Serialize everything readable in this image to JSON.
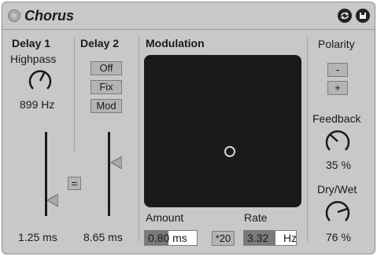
{
  "device": {
    "title": "Chorus",
    "power_icon": "power-icon",
    "hotswap_icon": "hotswap-icon",
    "save_icon": "save-icon"
  },
  "delay1": {
    "heading": "Delay 1",
    "highpass_label": "Highpass",
    "highpass_value": "899 Hz",
    "time_value": "1.25 ms",
    "fader_level": 0.2
  },
  "delay2": {
    "heading": "Delay 2",
    "mode_buttons": [
      "Off",
      "Fix",
      "Mod"
    ],
    "time_value": "8.65 ms",
    "fader_level": 0.6
  },
  "link_button": "=",
  "modulation": {
    "heading": "Modulation",
    "amount_label": "Amount",
    "amount_value": "0.80 ms",
    "rate_label": "Rate",
    "multiplier_button": "*20",
    "rate_value": "3.32",
    "rate_unit": "Hz"
  },
  "polarity": {
    "heading": "Polarity",
    "minus_label": "-",
    "plus_label": "+"
  },
  "feedback": {
    "label": "Feedback",
    "value": "35 %"
  },
  "drywet": {
    "label": "Dry/Wet",
    "value": "76 %"
  }
}
